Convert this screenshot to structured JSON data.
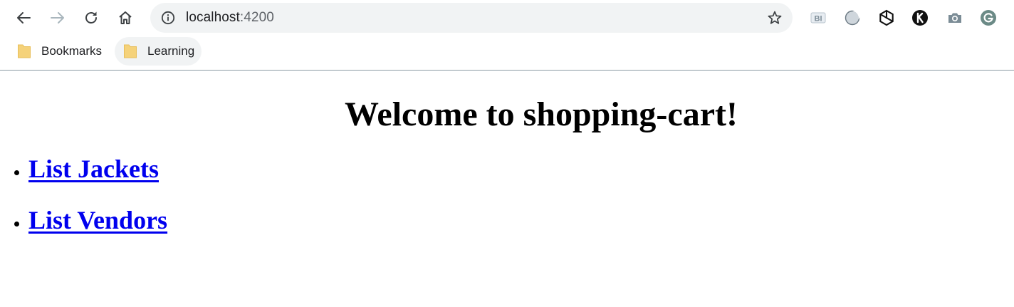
{
  "browser": {
    "address_bar": {
      "host": "localhost",
      "port": ":4200"
    },
    "toolbar_icons": [
      "back-arrow-icon",
      "forward-arrow-icon",
      "reload-icon",
      "home-icon",
      "info-icon",
      "star-icon"
    ],
    "extensions": [
      "bi-extension-icon",
      "circle-extension-icon",
      "openai-extension-icon",
      "k-extension-icon",
      "camera-extension-icon",
      "grammarly-extension-icon"
    ],
    "bookmarks": [
      {
        "label": "Bookmarks",
        "icon": "folder-icon"
      },
      {
        "label": "Learning",
        "icon": "folder-icon"
      }
    ]
  },
  "page": {
    "title": "Welcome to shopping-cart!",
    "links": [
      {
        "label": "List Jackets"
      },
      {
        "label": "List Vendors"
      }
    ]
  },
  "colors": {
    "link": "#0000ee",
    "omnibox_bg": "#f1f3f4",
    "folder": "#f5d27a",
    "divider": "#8a9aa3"
  }
}
